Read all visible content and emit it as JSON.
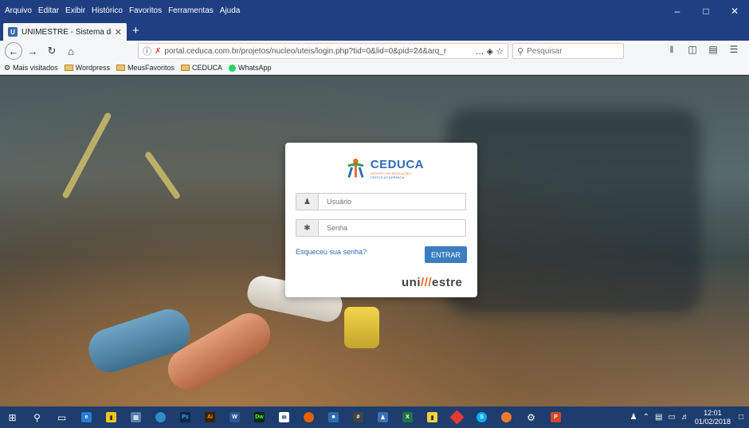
{
  "menu": [
    "Arquivo",
    "Editar",
    "Exibir",
    "Histórico",
    "Favoritos",
    "Ferramentas",
    "Ajuda"
  ],
  "window_controls": {
    "minimize": "–",
    "maximize": "□",
    "close": "✕"
  },
  "tab": {
    "title": "UNIMESTRE - Sistema de gestã",
    "close": "✕",
    "new_tab": "+"
  },
  "nav": {
    "back": "←",
    "forward": "→",
    "reload": "↻",
    "home": "⌂",
    "url": "portal.ceduca.com.br/projetos/nucleo/uteis/login.php?tid=0&lid=0&pid=24&arq_r",
    "page_actions": "… ◈ ☆",
    "search_placeholder": "Pesquisar"
  },
  "toolbar_icons": [
    "library-icon",
    "sidebar-icon",
    "reader-icon",
    "menu-icon"
  ],
  "bookmarks": [
    {
      "label": "Mais visitados",
      "icon": "gear-icon"
    },
    {
      "label": "Wordpress",
      "icon": "folder-icon"
    },
    {
      "label": "MeusFavoritos",
      "icon": "folder-icon"
    },
    {
      "label": "CEDUCA",
      "icon": "folder-icon"
    },
    {
      "label": "WhatsApp",
      "icon": "whatsapp-icon"
    }
  ],
  "login": {
    "logo_name": "CEDUCA",
    "logo_sub1": "CENTRO DE EDUCAÇÃO",
    "logo_sub2": "CRISTÃ ACADÊMICA",
    "username_placeholder": "Usuário",
    "password_placeholder": "Senha",
    "forgot_link": "Esqueceu sua senha?",
    "submit_label": "ENTRAR",
    "brand_prefix": "uni",
    "brand_slash": "///",
    "brand_suffix": "estre"
  },
  "taskbar": {
    "apps": [
      "windows-start-icon",
      "search-icon",
      "task-view-icon",
      "edge-icon",
      "store-icon",
      "files-icon",
      "chrome-icon",
      "photoshop-icon",
      "illustrator-icon",
      "word-icon",
      "dreamweaver-icon",
      "mail-icon",
      "firefox-icon",
      "app-icon",
      "calculator-icon",
      "people-icon",
      "excel-icon",
      "sticky-notes-icon",
      "git-icon",
      "skype-icon",
      "blender-icon",
      "settings-icon",
      "powerpoint-icon"
    ],
    "time": "12:01",
    "date": "01/02/2018"
  },
  "colors": {
    "accent": "#3a7ebf",
    "brand_orange": "#e46d2b",
    "brand_blue": "#2d6cb5",
    "taskbar": "#1d3d6e"
  }
}
